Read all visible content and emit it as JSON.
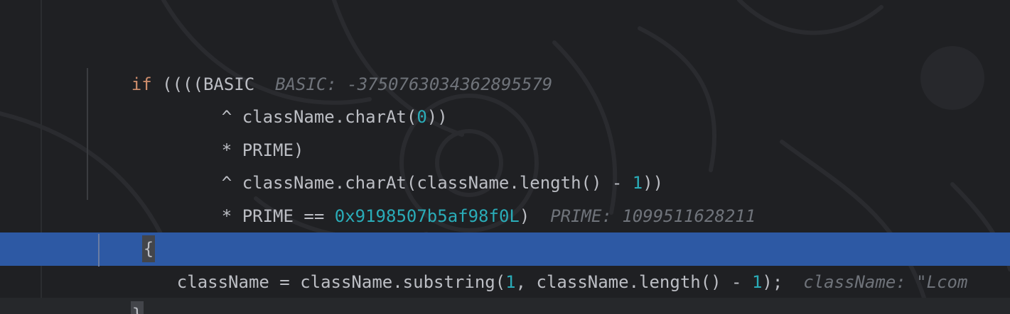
{
  "editor": {
    "lines": [
      {
        "kw": "if",
        "code": " ((((BASIC",
        "hint": "BASIC: -3750763034362895579"
      },
      {
        "pre": "^ className.charAt(",
        "num": "0",
        "post": "))"
      },
      {
        "code": "* PRIME)"
      },
      {
        "pre": "^ className.charAt(className.length() - ",
        "num": "1",
        "post": "))"
      },
      {
        "pre": "* PRIME == ",
        "num": "0x9198507b5af98f0L",
        "post": ")",
        "hint": "PRIME: 1099511628211"
      },
      {
        "brace": "{"
      },
      {
        "pre": "className = className.substring(",
        "num1": "1",
        "mid": ", className.length() - ",
        "num2": "1",
        "post": ");",
        "hint": "className: \"Lcom"
      },
      {
        "brace": "}"
      }
    ]
  },
  "colors": {
    "background": "#1f2023",
    "keyword": "#cf8e6d",
    "number": "#2aacb8",
    "text": "#bcbec4",
    "inlay_hint": "#6f737a",
    "execution_line": "#2d59a4"
  }
}
